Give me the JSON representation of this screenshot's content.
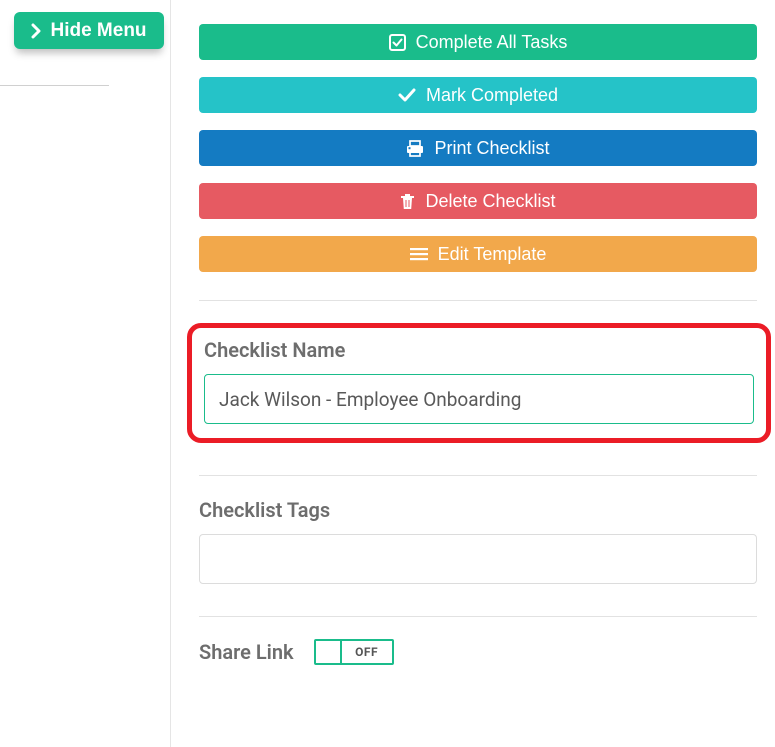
{
  "hideMenu": {
    "label": "Hide Menu"
  },
  "actions": {
    "completeAll": "Complete All Tasks",
    "markCompleted": "Mark Completed",
    "printChecklist": "Print Checklist",
    "deleteChecklist": "Delete Checklist",
    "editTemplate": "Edit Template"
  },
  "checklistName": {
    "label": "Checklist Name",
    "value": "Jack Wilson - Employee Onboarding"
  },
  "checklistTags": {
    "label": "Checklist Tags",
    "value": ""
  },
  "shareLink": {
    "label": "Share Link",
    "state": "OFF"
  }
}
